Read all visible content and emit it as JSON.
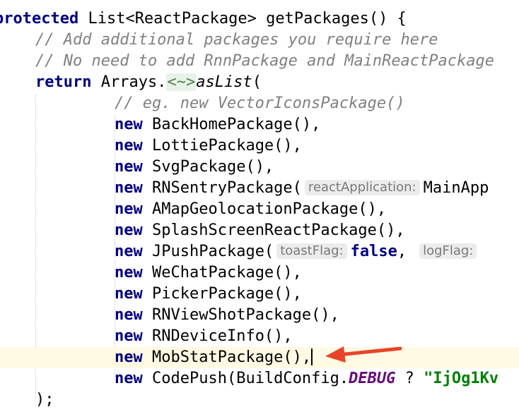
{
  "editor": {
    "lines": {
      "l1": {
        "kw": "protected",
        "rest": " List<ReactPackage> getPackages() {"
      },
      "l2": {
        "comment": "// Add additional packages you require here"
      },
      "l3": {
        "comment": "// No need to add RnnPackage and MainReactPackage"
      },
      "l4": {
        "kw": "return",
        "pre": " Arrays.",
        "fold": "<~>",
        "fn": "asList",
        "post": "("
      },
      "l5": {
        "comment": "// eg. new VectorIconsPackage()"
      },
      "l6": {
        "kw": "new",
        "rest": " BackHomePackage(),"
      },
      "l7": {
        "kw": "new",
        "rest": " LottiePackage(),"
      },
      "l8": {
        "kw": "new",
        "rest": " SvgPackage(),"
      },
      "l9": {
        "kw": "new",
        "pre": " RNSentryPackage(",
        "hint": "reactApplication:",
        "post": "MainApp"
      },
      "l10": {
        "kw": "new",
        "rest": " AMapGeolocationPackage(),"
      },
      "l11": {
        "kw": "new",
        "rest": " SplashScreenReactPackage(),"
      },
      "l12": {
        "kw": "new",
        "pre": " JPushPackage(",
        "hint1": "toastFlag:",
        "kw2": "false",
        "mid": ",",
        "hint2": "logFlag:"
      },
      "l13": {
        "kw": "new",
        "rest": " WeChatPackage(),"
      },
      "l14": {
        "kw": "new",
        "rest": " PickerPackage(),"
      },
      "l15": {
        "kw": "new",
        "rest": " RNViewShotPackage(),"
      },
      "l16": {
        "kw": "new",
        "rest": " RNDeviceInfo(),"
      },
      "l17": {
        "kw": "new",
        "rest": " MobStatPackage(),"
      },
      "l18": {
        "kw": "new",
        "pre": " CodePush(BuildConfig.",
        "static": "DEBUG",
        "mid": " ? ",
        "str": "\"IjOg1Kv"
      },
      "l19": {
        "rest": ");"
      }
    }
  },
  "colors": {
    "keyword": "#000080",
    "comment": "#808080",
    "static_field": "#660e7a",
    "string": "#008000",
    "current_line": "#fffae3",
    "annotation_arrow": "#e8442a"
  },
  "annotation": {
    "type": "arrow",
    "icon": "red-arrow-icon",
    "target": "line 17 caret"
  }
}
